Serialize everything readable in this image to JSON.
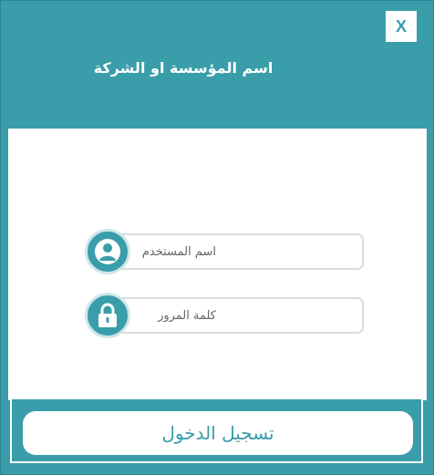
{
  "header": {
    "org_title": "اسم المؤسسة او الشركة",
    "close_label": "X"
  },
  "form": {
    "username_placeholder": "اسم المستخدم",
    "password_placeholder": "كلمة المرور",
    "login_label": "تسجيل الدخول"
  },
  "icons": {
    "username": "user-icon",
    "password": "lock-icon"
  },
  "colors": {
    "accent": "#3a9daa",
    "background": "#ffffff",
    "input_border": "#dcdcdc"
  }
}
